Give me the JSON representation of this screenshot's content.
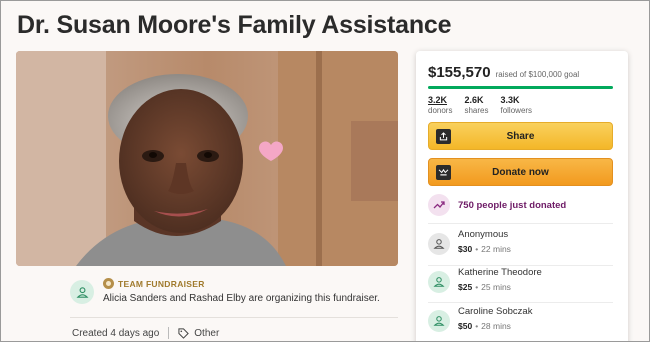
{
  "page": {
    "title": "Dr. Susan Moore's Family Assistance"
  },
  "organizer": {
    "badge": "TEAM FUNDRAISER",
    "text": "Alicia Sanders and Rashad Elby are organizing this fundraiser."
  },
  "meta": {
    "created": "Created 4 days ago",
    "category": "Other"
  },
  "donation_card": {
    "amount_raised": "$155,570",
    "goal_text": "raised of $100,000 goal",
    "progress_fraction": 1.0,
    "stats": [
      {
        "value": "3.2K",
        "label": "donors"
      },
      {
        "value": "2.6K",
        "label": "shares"
      },
      {
        "value": "3.3K",
        "label": "followers"
      }
    ],
    "share_label": "Share",
    "donate_label": "Donate now",
    "just_donated": "750 people just donated",
    "donations": [
      {
        "name": "Anonymous",
        "amount": "$30",
        "time": "22 mins",
        "avatar_color": "#e6e6e6"
      },
      {
        "name": "Katherine Theodore",
        "amount": "$25",
        "time": "25 mins",
        "avatar_color": "#d8efe3"
      },
      {
        "name": "Caroline Sobczak",
        "amount": "$50",
        "time": "28 mins",
        "avatar_color": "#d8efe3"
      }
    ]
  },
  "colors": {
    "progress": "#02a95c",
    "share_button": "#f6c343",
    "donate_button": "#f4a52a",
    "just_donated_text": "#6e1b66"
  }
}
